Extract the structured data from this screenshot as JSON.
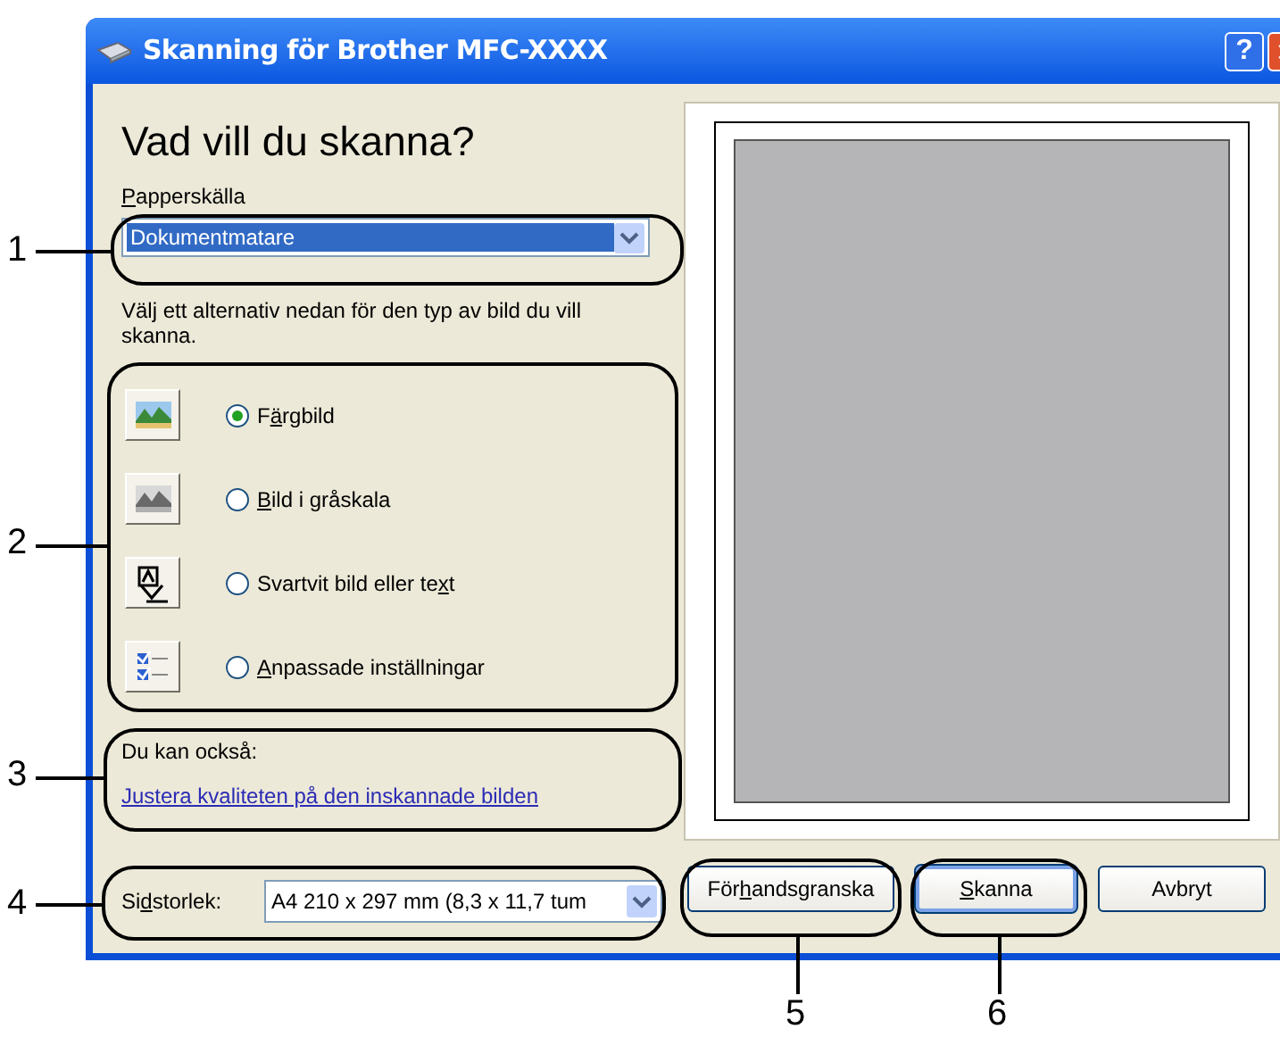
{
  "window": {
    "title": "Skanning för Brother MFC-XXXX",
    "help_glyph": "?"
  },
  "heading": "Vad vill du skanna?",
  "paper_source": {
    "label": [
      {
        "text": "P",
        "underline": true
      },
      {
        "text": "apperskälla",
        "underline": false
      }
    ],
    "value": "Dokumentmatare"
  },
  "instruction": "Välj ett alternativ nedan för den typ av bild du vill skanna.",
  "scan_types": [
    {
      "label": [
        {
          "text": "F",
          "underline": false
        },
        {
          "text": "ä",
          "underline": true
        },
        {
          "text": "rgbild",
          "underline": false
        }
      ],
      "selected": true,
      "kind": "color"
    },
    {
      "label": [
        {
          "text": "B",
          "underline": true
        },
        {
          "text": "ild i gråskala",
          "underline": false
        }
      ],
      "selected": false,
      "kind": "gray"
    },
    {
      "label": [
        {
          "text": "Svartvit bild eller te",
          "underline": false
        },
        {
          "text": "x",
          "underline": true
        },
        {
          "text": "t",
          "underline": false
        }
      ],
      "selected": false,
      "kind": "bw"
    },
    {
      "label": [
        {
          "text": "A",
          "underline": true
        },
        {
          "text": "npassade inställningar",
          "underline": false
        }
      ],
      "selected": false,
      "kind": "custom"
    }
  ],
  "also": {
    "label": "Du kan också:",
    "link": "Justera kvaliteten på den inskannade bilden"
  },
  "page_size": {
    "label": [
      {
        "text": "Si",
        "underline": false
      },
      {
        "text": "d",
        "underline": true
      },
      {
        "text": "storlek:",
        "underline": false
      }
    ],
    "value": "A4 210 x 297 mm (8,3 x 11,7 tum"
  },
  "buttons": [
    {
      "label": [
        {
          "text": "För",
          "underline": false
        },
        {
          "text": "h",
          "underline": true
        },
        {
          "text": "andsgranska",
          "underline": false
        }
      ],
      "default": false
    },
    {
      "label": [
        {
          "text": "S",
          "underline": true
        },
        {
          "text": "kanna",
          "underline": false
        }
      ],
      "default": true
    },
    {
      "label": [
        {
          "text": "Avbryt",
          "underline": false
        }
      ],
      "default": false
    }
  ],
  "callouts": [
    "1",
    "2",
    "3",
    "4",
    "5",
    "6"
  ]
}
